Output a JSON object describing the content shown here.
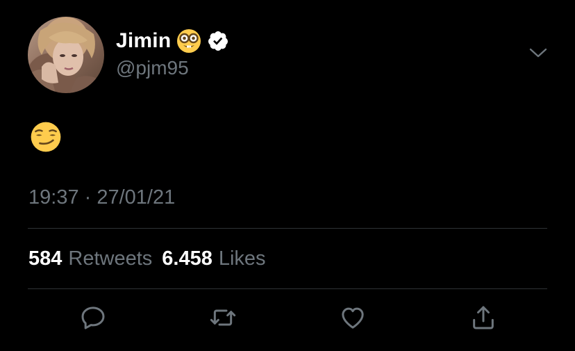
{
  "user": {
    "name": "Jimin",
    "handle": "@pjm95"
  },
  "tweet": {
    "text": "😏",
    "timestamp": "19:37 · 27/01/21"
  },
  "stats": {
    "retweets_count": "584",
    "retweets_label": "Retweets",
    "likes_count": "6.458",
    "likes_label": "Likes"
  },
  "icons": {
    "name_emoji": "nerd-face-icon",
    "verified": "verified-badge-icon",
    "menu": "chevron-down-icon",
    "reply": "reply-icon",
    "retweet": "retweet-icon",
    "like": "heart-icon",
    "share": "share-icon"
  },
  "colors": {
    "background": "#000000",
    "primary_text": "#ffffff",
    "secondary_text": "#6e767d",
    "divider": "#2f3336",
    "emoji_yellow": "#ffcc4d"
  }
}
